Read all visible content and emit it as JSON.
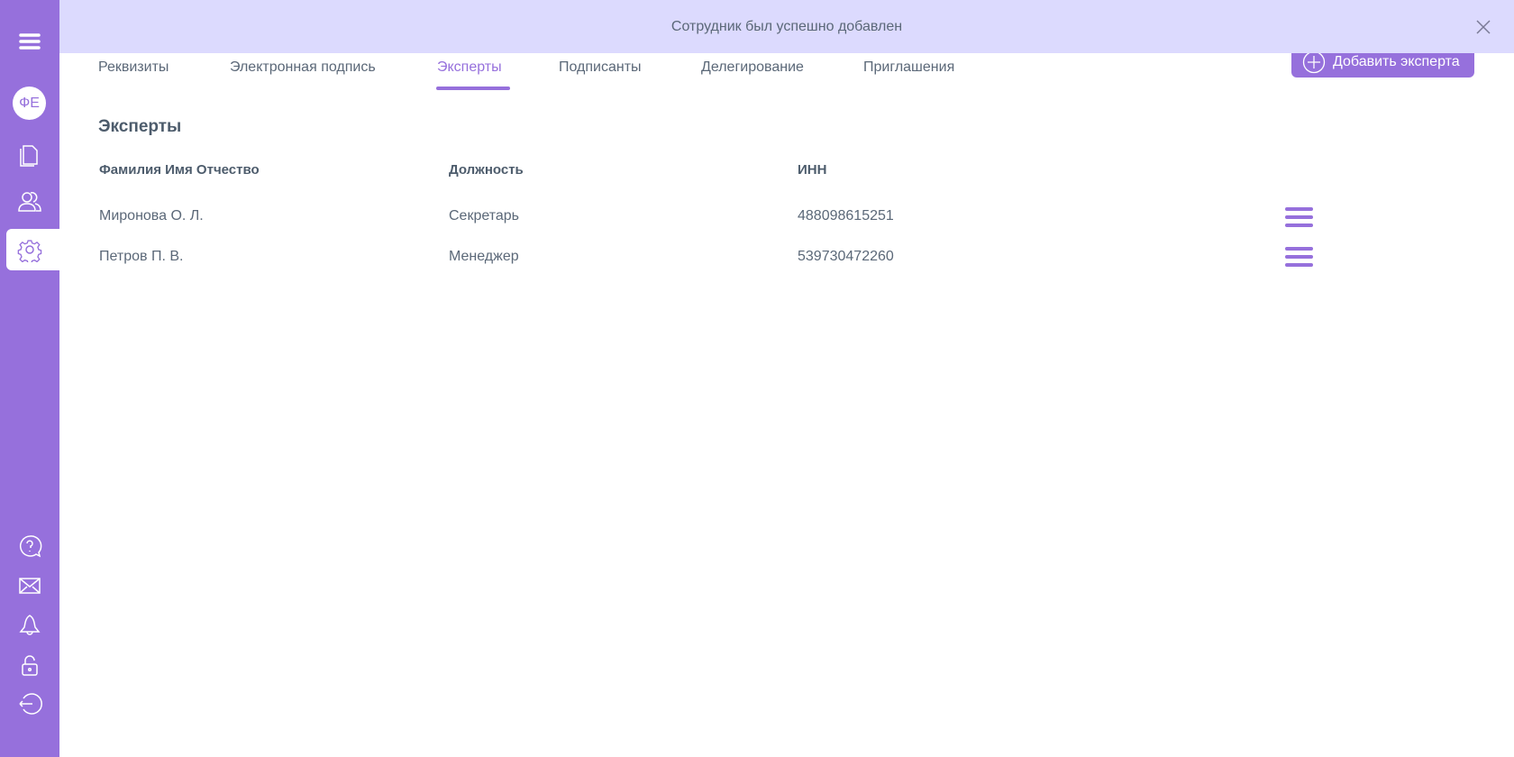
{
  "notification": {
    "text": "Сотрудник был успешно добавлен"
  },
  "sidebar": {
    "avatar_initials": "ФЕ"
  },
  "tabs": [
    {
      "label": "Реквизиты"
    },
    {
      "label": "Электронная подпись"
    },
    {
      "label": "Эксперты"
    },
    {
      "label": "Подписанты"
    },
    {
      "label": "Делегирование"
    },
    {
      "label": "Приглашения"
    }
  ],
  "add_button": {
    "label": "Добавить эксперта"
  },
  "section_title": "Эксперты",
  "table": {
    "headers": [
      "Фамилия Имя Отчество",
      "Должность",
      "ИНН"
    ],
    "rows": [
      [
        "Миронова О. Л.",
        "Секретарь",
        "488098615251"
      ],
      [
        "Петров П. В.",
        "Менеджер",
        "539730472260"
      ]
    ]
  },
  "colors": {
    "accent": "#9670dc",
    "banner": "#dcdafe"
  }
}
